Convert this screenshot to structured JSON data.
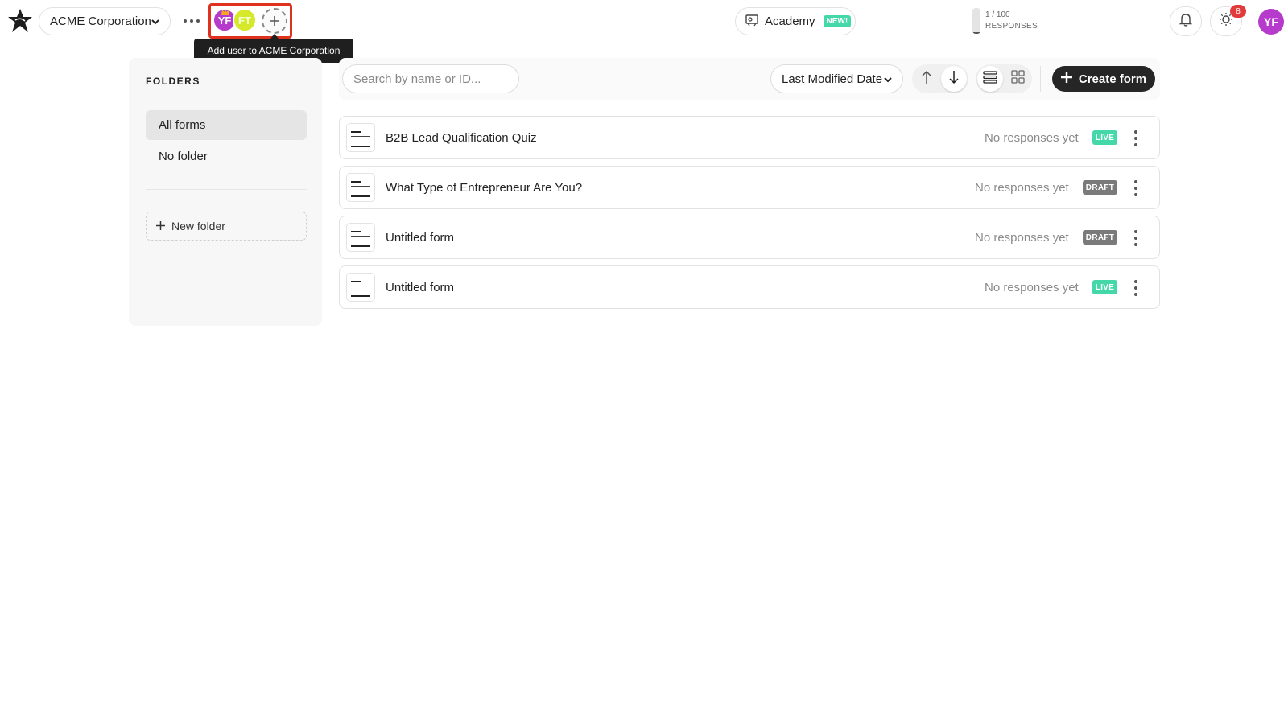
{
  "header": {
    "workspace": "ACME Corporation",
    "collaborators": [
      "YF",
      "FT"
    ],
    "tooltip": "Add user to ACME Corporation",
    "academy_label": "Academy",
    "academy_badge": "NEW!",
    "responses_count": "1 / 100",
    "responses_label": "RESPONSES",
    "responses_fraction": 0.01,
    "notification_count": "8",
    "profile_initials": "YF"
  },
  "sidebar": {
    "title": "FOLDERS",
    "items": [
      {
        "label": "All forms",
        "active": true
      },
      {
        "label": "No folder",
        "active": false
      }
    ],
    "new_folder": "New folder"
  },
  "toolbar": {
    "search_placeholder": "Search by name or ID...",
    "sort_label": "Last Modified Date",
    "create_label": "Create form"
  },
  "forms": [
    {
      "title": "B2B Lead Qualification Quiz",
      "responses": "No responses yet",
      "status": "LIVE"
    },
    {
      "title": "What Type of Entrepreneur Are You?",
      "responses": "No responses yet",
      "status": "DRAFT"
    },
    {
      "title": "Untitled form",
      "responses": "No responses yet",
      "status": "DRAFT"
    },
    {
      "title": "Untitled form",
      "responses": "No responses yet",
      "status": "LIVE"
    }
  ],
  "colors": {
    "live": "#44d7a8",
    "draft": "#7a7a7a",
    "accent_dark": "#262627",
    "avatar_purple": "#b63acb",
    "highlight": "#e0301e"
  }
}
